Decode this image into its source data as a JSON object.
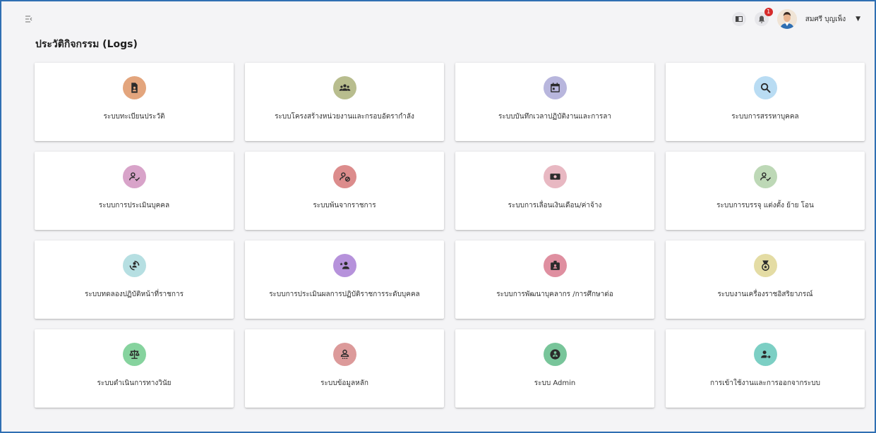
{
  "page": {
    "title": "ประวัติกิจกรรม (Logs)"
  },
  "header": {
    "notification_count": "1",
    "user_name": "สมศรี บุญเพ็ง"
  },
  "cards": [
    {
      "label": "ระบบทะเบียนประวัติ",
      "icon": "profile-document-icon",
      "color": "#e3a57d"
    },
    {
      "label": "ระบบโครงสร้างหน่วยงานและกรอบอัตรากำลัง",
      "icon": "group-icon",
      "color": "#b8bd8e"
    },
    {
      "label": "ระบบบันทึกเวลาปฏิบัติงานและการลา",
      "icon": "calendar-icon",
      "color": "#b8b6dd"
    },
    {
      "label": "ระบบการสรรหาบุคคล",
      "icon": "search-icon",
      "color": "#b9dcf3"
    },
    {
      "label": "ระบบการประเมินบุคคล",
      "icon": "person-check-icon",
      "color": "#d8a3c9"
    },
    {
      "label": "ระบบพ้นจากราชการ",
      "icon": "person-block-icon",
      "color": "#dc8c8c"
    },
    {
      "label": "ระบบการเลื่อนเงินเดือน/ค่าจ้าง",
      "icon": "money-icon",
      "color": "#e8b8c2"
    },
    {
      "label": "ระบบการบรรจุ แต่งตั้ง ย้าย โอน",
      "icon": "person-check-icon",
      "color": "#bdd8b6"
    },
    {
      "label": "ระบบทดลองปฏิบัติหน้าที่ราชการ",
      "icon": "person-cycle-icon",
      "color": "#b6dfe2"
    },
    {
      "label": "ระบบการประเมินผลการปฏิบัติราชการระดับบุคคล",
      "icon": "person-star-icon",
      "color": "#b692db"
    },
    {
      "label": "ระบบการพัฒนาบุคลากร /การศึกษาต่อ",
      "icon": "badge-icon",
      "color": "#df8fa0"
    },
    {
      "label": "ระบบงานเครื่องราชอิสริยาภรณ์",
      "icon": "medal-icon",
      "color": "#e4dca4"
    },
    {
      "label": "ระบบดำเนินการทางวินัย",
      "icon": "scale-icon",
      "color": "#86d39e"
    },
    {
      "label": "ระบบข้อมูลหลัก",
      "icon": "person-data-icon",
      "color": "#dc9a9a"
    },
    {
      "label": "ระบบ Admin",
      "icon": "admin-icon",
      "color": "#78c59a"
    },
    {
      "label": "การเข้าใช้งานและการออกจากระบบ",
      "icon": "person-arrow-icon",
      "color": "#7ccfc4"
    }
  ]
}
